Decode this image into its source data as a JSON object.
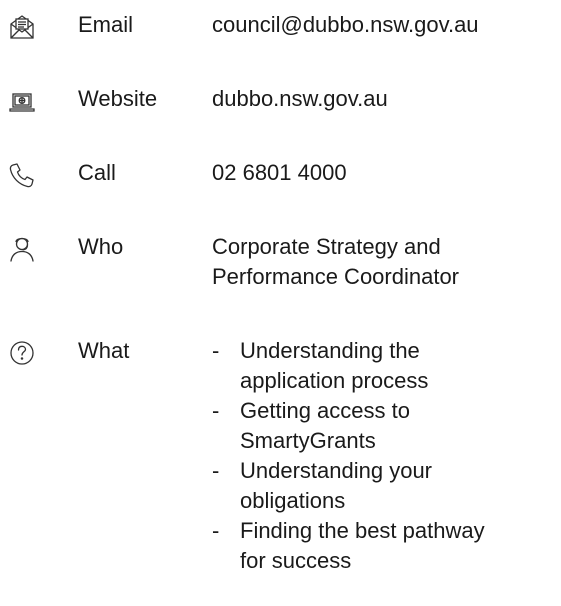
{
  "contacts": [
    {
      "icon": "email-icon",
      "label": "Email",
      "value": "council@dubbo.nsw.gov.au"
    },
    {
      "icon": "laptop-icon",
      "label": "Website",
      "value": "dubbo.nsw.gov.au"
    },
    {
      "icon": "phone-icon",
      "label": "Call",
      "value": "02 6801 4000"
    },
    {
      "icon": "person-headset-icon",
      "label": "Who",
      "value_lines": [
        "Corporate Strategy and",
        "Performance Coordinator"
      ]
    },
    {
      "icon": "question-icon",
      "label": "What",
      "items": [
        {
          "lines": [
            "Understanding the",
            "application process"
          ]
        },
        {
          "lines": [
            "Getting access to",
            "SmartyGrants"
          ]
        },
        {
          "lines": [
            "Understanding your",
            "obligations"
          ]
        },
        {
          "lines": [
            "Finding the best pathway",
            "for success"
          ]
        }
      ],
      "bullet": "-"
    }
  ]
}
